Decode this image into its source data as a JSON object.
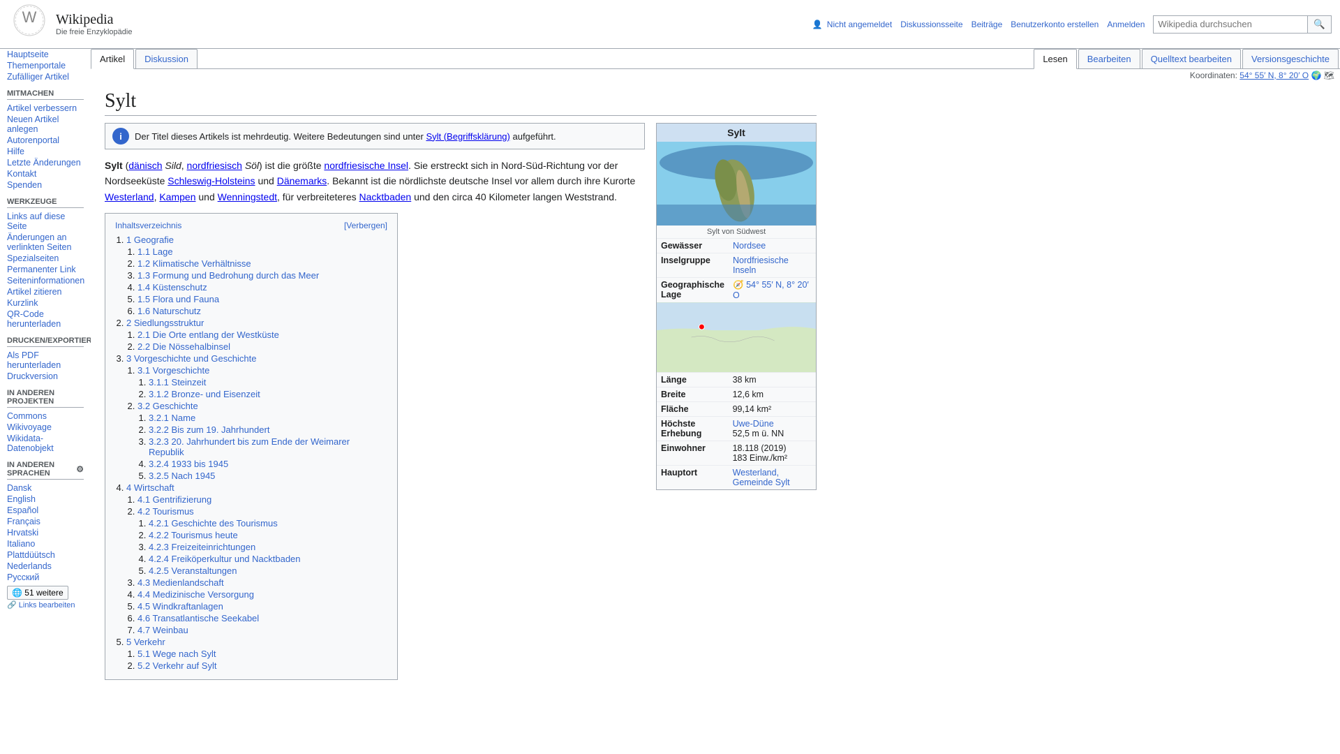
{
  "site": {
    "name": "Wikipedia",
    "tagline": "Die freie Enzyklopädie"
  },
  "header": {
    "user_actions": [
      {
        "label": "Nicht angemeldet",
        "href": "#"
      },
      {
        "label": "Diskussionsseite",
        "href": "#"
      },
      {
        "label": "Beiträge",
        "href": "#"
      },
      {
        "label": "Benutzerkonto erstellen",
        "href": "#"
      },
      {
        "label": "Anmelden",
        "href": "#"
      }
    ],
    "search_placeholder": "Wikipedia durchsuchen"
  },
  "tabs": [
    {
      "label": "Artikel",
      "active": true
    },
    {
      "label": "Diskussion",
      "active": false
    }
  ],
  "tabs_right": [
    {
      "label": "Lesen",
      "active": true
    },
    {
      "label": "Bearbeiten",
      "active": false
    },
    {
      "label": "Quelltext bearbeiten",
      "active": false
    },
    {
      "label": "Versionsgeschichte",
      "active": false
    }
  ],
  "article": {
    "title": "Sylt",
    "coordinates_label": "Koordinaten:",
    "coordinates": "54° 55′ N, 8° 20′ O",
    "disambig_text": "Der Titel dieses Artikels ist mehrdeutig. Weitere Bedeutungen sind unter",
    "disambig_link": "Sylt (Begriffsklärung)",
    "disambig_suffix": "aufgeführt.",
    "intro": "Sylt (dänisch Sild, nordfriesisch Söl) ist die größte nordfriesische Insel. Sie erstreckt sich in Nord-Süd-Richtung vor der Nordseeküste Schleswig-Holsteins und Dänemarks. Bekannt ist die nördlichste deutsche Insel vor allem durch ihre Kurorte Westerland, Kampen und Wenningstedt, für verbreiteteres Nacktbaden und den circa 40 Kilometer langen Weststrand."
  },
  "infobox": {
    "title": "Sylt",
    "image_caption": "Sylt von Südwest",
    "rows": [
      {
        "label": "Gewässer",
        "value": "Nordsee",
        "link": true
      },
      {
        "label": "Inselgruppe",
        "value": "Nordfriesische Inseln",
        "link": true
      },
      {
        "label": "Geographische Lage",
        "value": "54° 55′ N, 8° 20′ O",
        "link": true
      },
      {
        "label": "Länge",
        "value": "38 km"
      },
      {
        "label": "Breite",
        "value": "12,6 km"
      },
      {
        "label": "Fläche",
        "value": "99,14 km²"
      },
      {
        "label": "Höchste Erhebung",
        "value": "Uwe-Düne",
        "value2": "52,5 m ü. NN",
        "link": true
      },
      {
        "label": "Einwohner",
        "value": "18.118 (2019)",
        "value2": "183 Einw./km²"
      },
      {
        "label": "Hauptort",
        "value": "Westerland, Gemeinde Sylt",
        "link": true
      }
    ]
  },
  "toc": {
    "title": "Inhaltsverzeichnis",
    "toggle_label": "[Verbergen]",
    "items": [
      {
        "num": "1",
        "label": "Geografie",
        "sub": [
          {
            "num": "1.1",
            "label": "Lage"
          },
          {
            "num": "1.2",
            "label": "Klimatische Verhältnisse"
          },
          {
            "num": "1.3",
            "label": "Formung und Bedrohung durch das Meer"
          },
          {
            "num": "1.4",
            "label": "Küstenschutz"
          },
          {
            "num": "1.5",
            "label": "Flora und Fauna"
          },
          {
            "num": "1.6",
            "label": "Naturschutz"
          }
        ]
      },
      {
        "num": "2",
        "label": "Siedlungsstruktur",
        "sub": [
          {
            "num": "2.1",
            "label": "Die Orte entlang der Westküste"
          },
          {
            "num": "2.2",
            "label": "Die Nössehalbinsel"
          }
        ]
      },
      {
        "num": "3",
        "label": "Vorgeschichte und Geschichte",
        "sub": [
          {
            "num": "3.1",
            "label": "Vorgeschichte",
            "subsub": [
              {
                "num": "3.1.1",
                "label": "Steinzeit"
              },
              {
                "num": "3.1.2",
                "label": "Bronze- und Eisenzeit"
              }
            ]
          },
          {
            "num": "3.2",
            "label": "Geschichte",
            "subsub": [
              {
                "num": "3.2.1",
                "label": "Name"
              },
              {
                "num": "3.2.2",
                "label": "Bis zum 19. Jahrhundert"
              },
              {
                "num": "3.2.3",
                "label": "20. Jahrhundert bis zum Ende der Weimarer Republik"
              },
              {
                "num": "3.2.4",
                "label": "1933 bis 1945"
              },
              {
                "num": "3.2.5",
                "label": "Nach 1945"
              }
            ]
          }
        ]
      },
      {
        "num": "4",
        "label": "Wirtschaft",
        "sub": [
          {
            "num": "4.1",
            "label": "Gentrifizierung"
          },
          {
            "num": "4.2",
            "label": "Tourismus",
            "subsub": [
              {
                "num": "4.2.1",
                "label": "Geschichte des Tourismus"
              },
              {
                "num": "4.2.2",
                "label": "Tourismus heute"
              },
              {
                "num": "4.2.3",
                "label": "Freizeiteinrichtungen"
              },
              {
                "num": "4.2.4",
                "label": "Freiköperkultur und Nacktbaden"
              },
              {
                "num": "4.2.5",
                "label": "Veranstaltungen"
              }
            ]
          },
          {
            "num": "4.3",
            "label": "Medienlandschaft"
          },
          {
            "num": "4.4",
            "label": "Medizinische Versorgung"
          },
          {
            "num": "4.5",
            "label": "Windkraftanlagen"
          },
          {
            "num": "4.6",
            "label": "Transatlantische Seekabel"
          },
          {
            "num": "4.7",
            "label": "Weinbau"
          }
        ]
      },
      {
        "num": "5",
        "label": "Verkehr",
        "sub": [
          {
            "num": "5.1",
            "label": "Wege nach Sylt"
          },
          {
            "num": "5.2",
            "label": "Verkehr auf Sylt"
          }
        ]
      }
    ]
  },
  "sidebar": {
    "sections": [
      {
        "title": "",
        "items": [
          {
            "label": "Hauptseite",
            "href": "#"
          },
          {
            "label": "Themenportale",
            "href": "#"
          },
          {
            "label": "Zufälliger Artikel",
            "href": "#"
          }
        ]
      },
      {
        "title": "Mitmachen",
        "items": [
          {
            "label": "Artikel verbessern",
            "href": "#"
          },
          {
            "label": "Neuen Artikel anlegen",
            "href": "#"
          },
          {
            "label": "Autorenportal",
            "href": "#"
          },
          {
            "label": "Hilfe",
            "href": "#"
          },
          {
            "label": "Letzte Änderungen",
            "href": "#"
          },
          {
            "label": "Kontakt",
            "href": "#"
          },
          {
            "label": "Spenden",
            "href": "#"
          }
        ]
      },
      {
        "title": "Werkzeuge",
        "items": [
          {
            "label": "Links auf diese Seite",
            "href": "#"
          },
          {
            "label": "Änderungen an verlinkten Seiten",
            "href": "#"
          },
          {
            "label": "Spezialseiten",
            "href": "#"
          },
          {
            "label": "Permanenter Link",
            "href": "#"
          },
          {
            "label": "Seiteninformationen",
            "href": "#"
          },
          {
            "label": "Artikel zitieren",
            "href": "#"
          },
          {
            "label": "Kurzlink",
            "href": "#"
          },
          {
            "label": "QR-Code herunterladen",
            "href": "#"
          }
        ]
      },
      {
        "title": "Drucken/exportieren",
        "items": [
          {
            "label": "Als PDF herunterladen",
            "href": "#"
          },
          {
            "label": "Druckversion",
            "href": "#"
          }
        ]
      },
      {
        "title": "In anderen Projekten",
        "items": [
          {
            "label": "Commons",
            "href": "#"
          },
          {
            "label": "Wikivoyage",
            "href": "#"
          },
          {
            "label": "Wikidata-Datenobjekt",
            "href": "#"
          }
        ]
      },
      {
        "title": "In anderen Sprachen",
        "items": [
          {
            "label": "Dansk",
            "href": "#"
          },
          {
            "label": "English",
            "href": "#"
          },
          {
            "label": "Español",
            "href": "#"
          },
          {
            "label": "Français",
            "href": "#"
          },
          {
            "label": "Hrvatski",
            "href": "#"
          },
          {
            "label": "Italiano",
            "href": "#"
          },
          {
            "label": "Plattdüütsch",
            "href": "#"
          },
          {
            "label": "Nederlands",
            "href": "#"
          },
          {
            "label": "Русский",
            "href": "#"
          }
        ]
      }
    ],
    "more_languages_button": "51 weitere",
    "links_edit_label": "Links bearbeiten"
  }
}
